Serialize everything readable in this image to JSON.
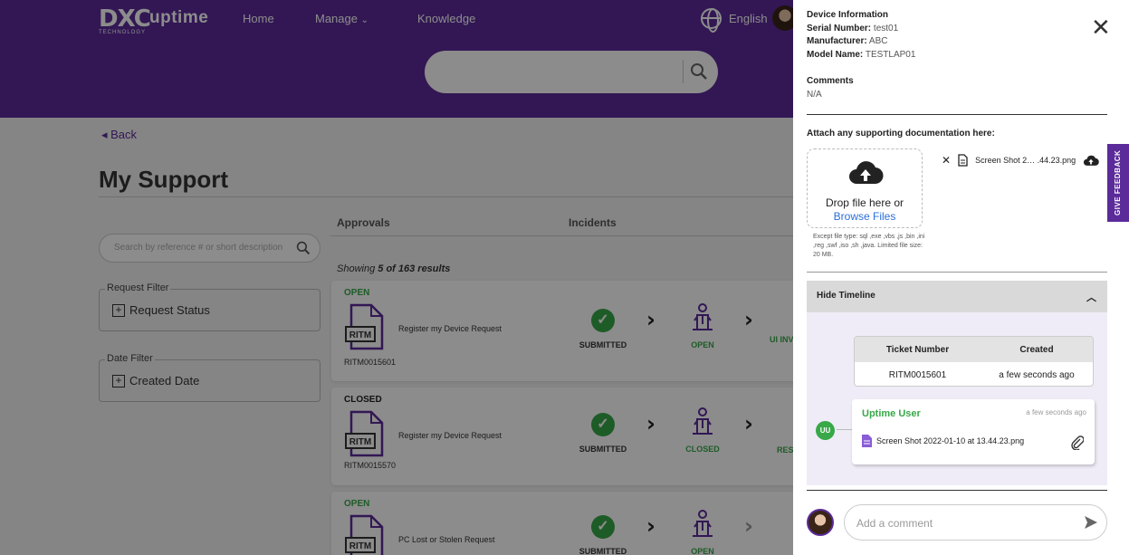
{
  "header": {
    "logo_mark": "DXC",
    "logo_sub": "TECHNOLOGY",
    "logo_name": "uptime",
    "nav": {
      "home": "Home",
      "manage": "Manage",
      "knowledge": "Knowledge"
    },
    "language": "English"
  },
  "page": {
    "back": "◂ Back",
    "title": "My Support",
    "tabs": [
      "Approvals",
      "Incidents"
    ],
    "search_placeholder": "Search by reference # or short description",
    "filters": {
      "request_legend": "Request Filter",
      "request_value": "Request Status",
      "date_legend": "Date Filter",
      "date_value": "Created Date"
    },
    "showing_prefix": "Showing ",
    "showing_count": "5 of 163 results",
    "cards": [
      {
        "status": "OPEN",
        "status_color": "#38a848",
        "number": "RITM0015601",
        "request": "Register my Device Request",
        "steps": [
          "SUBMITTED",
          "OPEN",
          "UI INVES"
        ]
      },
      {
        "status": "CLOSED",
        "status_color": "#222222",
        "number": "RITM0015570",
        "request": "Register my Device Request",
        "steps": [
          "SUBMITTED",
          "CLOSED",
          "RES"
        ]
      },
      {
        "status": "OPEN",
        "status_color": "#38a848",
        "number": "",
        "request": "PC Lost or Stolen Request",
        "steps": [
          "SUBMITTED",
          "OPEN"
        ]
      }
    ],
    "icon_label": "RITM"
  },
  "drawer": {
    "device_title": "Device Information",
    "serial_label": "Serial Number:",
    "serial_value": " test01",
    "manufacturer_label": "Manufacturer:",
    "manufacturer_value": " ABC",
    "model_label": "Model Name:",
    "model_value": " TESTLAP01",
    "comments_label": "Comments",
    "comments_value": "N/A",
    "attach_label": "Attach any supporting documentation here:",
    "drop_text": "Drop file here or",
    "browse_text": "Browse Files",
    "hint": "Except file type: sql ,exe ,vbs ,js ,bin ,ini ,reg ,swf ,iso ,sh ,java. Limited file size: 20 MB.",
    "attached_file": "Screen Shot 2… .44.23.png",
    "timeline_toggle": "Hide Timeline",
    "ticket_table": {
      "headers": [
        "Ticket Number",
        "Created"
      ],
      "row": [
        "RITM0015601",
        "a few seconds ago"
      ]
    },
    "comment": {
      "initials": "UU",
      "author": "Uptime User",
      "time": "a few seconds ago",
      "file": "Screen Shot 2022-01-10 at 13.44.23.png"
    },
    "add_comment_placeholder": "Add a comment"
  },
  "feedback": "GIVE FEEDBACK",
  "colors": {
    "brand": "#5b2b99",
    "success": "#38a848",
    "link": "#2a6fdb"
  }
}
